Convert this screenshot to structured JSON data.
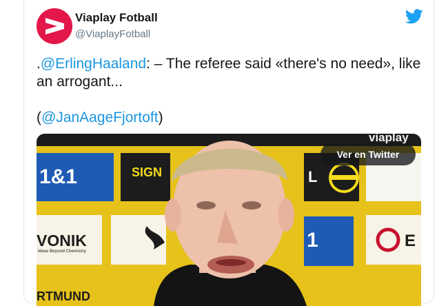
{
  "account": {
    "display_name": "Viaplay Fotball",
    "handle": "@ViaplayFotball",
    "avatar_icon": "viaplay-logo-icon",
    "brand_color": "#e4174a"
  },
  "platform_icon": "twitter-bird-icon",
  "tweet": {
    "lead": ".",
    "mention_1": "@ErlingHaaland",
    "body": ": – The referee said «there's no need», like an arrogant...",
    "open_paren": "(",
    "mention_2": "@JanAageFjortoft",
    "close_paren": ")"
  },
  "media": {
    "watermark": "viaplay",
    "view_button_label": "Ver en Twitter",
    "boards": {
      "sponsor_1": "1&1",
      "sponsor_2": "SIGN",
      "sponsor_3": "L",
      "sponsor_4": "VONIK",
      "sponsor_4_sub": "Ideas Beyond Chemistry",
      "sponsor_5": "1",
      "sponsor_6": "E",
      "bottom": "RTMUND"
    }
  },
  "colors": {
    "mention": "#1b95e0",
    "board_yellow": "#f5dc1c",
    "board_blue": "#1e5bb5"
  }
}
